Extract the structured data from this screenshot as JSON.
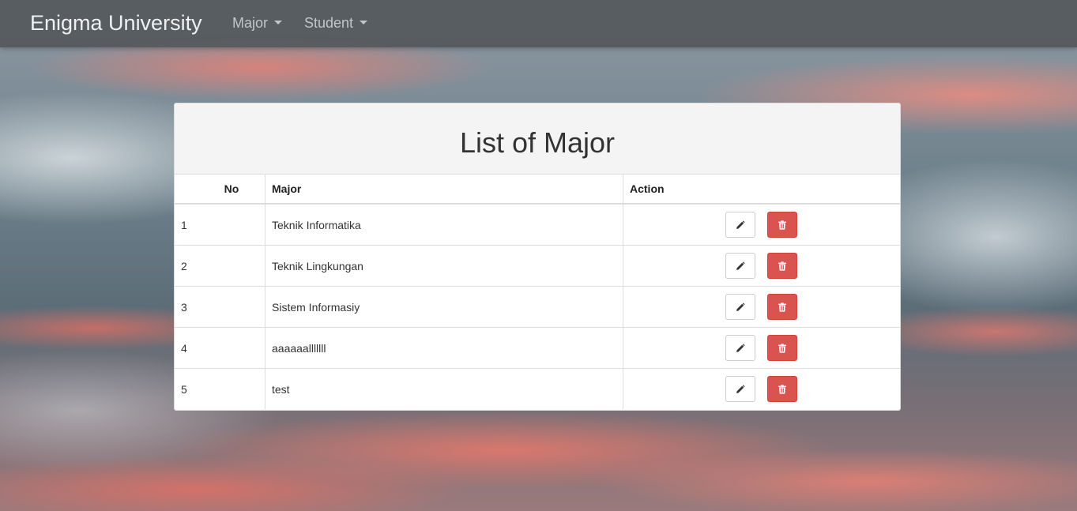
{
  "navbar": {
    "brand": "Enigma University",
    "menus": [
      {
        "label": "Major"
      },
      {
        "label": "Student"
      }
    ]
  },
  "panel": {
    "title": "List of Major"
  },
  "table": {
    "headers": {
      "no": "No",
      "major": "Major",
      "action": "Action"
    },
    "rows": [
      {
        "no": "1",
        "major": "Teknik Informatika"
      },
      {
        "no": "2",
        "major": "Teknik Lingkungan"
      },
      {
        "no": "3",
        "major": "Sistem Informasiy"
      },
      {
        "no": "4",
        "major": "aaaaaalllllll"
      },
      {
        "no": "5",
        "major": "test"
      }
    ]
  },
  "icons": {
    "edit": "pencil-icon",
    "delete": "trash-icon",
    "dropdown": "caret-down-icon"
  },
  "colors": {
    "navbar_bg": "#54585c",
    "delete_button": "#d9534f",
    "panel_heading_bg": "#f4f4f4"
  }
}
